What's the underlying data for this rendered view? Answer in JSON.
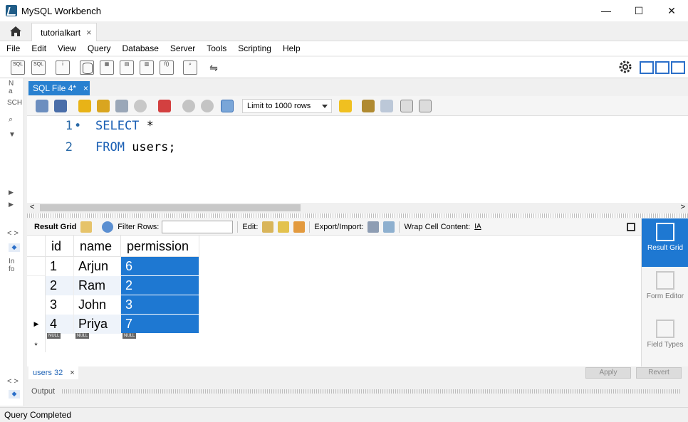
{
  "window": {
    "title": "MySQL Workbench",
    "minimize": "—",
    "maximize": "☐",
    "close": "✕"
  },
  "connection_tab": {
    "label": "tutorialkart",
    "close": "×"
  },
  "menu": [
    "File",
    "Edit",
    "View",
    "Query",
    "Database",
    "Server",
    "Tools",
    "Scripting",
    "Help"
  ],
  "left_strip": {
    "nav_letters": "N\na",
    "schemas_abbr": "SCH",
    "info_abbr": "In\nfo"
  },
  "sql_tab": {
    "label": "SQL File 4*",
    "close": "×"
  },
  "editor_toolbar": {
    "limit_select": "Limit to 1000 rows"
  },
  "editor": {
    "lines": [
      {
        "num": "1",
        "marker": "•",
        "keyword": "SELECT",
        "rest": " *"
      },
      {
        "num": "2",
        "marker": "",
        "keyword": "FROM",
        "rest": " users;"
      }
    ]
  },
  "result_toolbar": {
    "result_grid": "Result Grid",
    "filter_rows": "Filter Rows:",
    "filter_value": "",
    "edit": "Edit:",
    "export_import": "Export/Import:",
    "wrap_cell": "Wrap Cell Content:"
  },
  "grid": {
    "columns": [
      "id",
      "name",
      "permission"
    ],
    "rows": [
      [
        "1",
        "Arjun",
        "6"
      ],
      [
        "2",
        "Ram",
        "2"
      ],
      [
        "3",
        "John",
        "3"
      ],
      [
        "4",
        "Priya",
        "7"
      ]
    ],
    "null_label": "NULL",
    "new_row_marker": "*",
    "current_row_marker": "▶"
  },
  "side_panel": {
    "result_grid": "Result Grid",
    "form_editor": "Form Editor",
    "field_types": "Field Types"
  },
  "result_tabs": {
    "tab_label": "users 32",
    "close": "×",
    "apply": "Apply",
    "revert": "Revert"
  },
  "output": {
    "label": "Output"
  },
  "status": {
    "text": "Query Completed"
  },
  "colors": {
    "accent": "#1e78d2",
    "tab_blue": "#2880d0",
    "keyword": "#1a5fb4"
  }
}
